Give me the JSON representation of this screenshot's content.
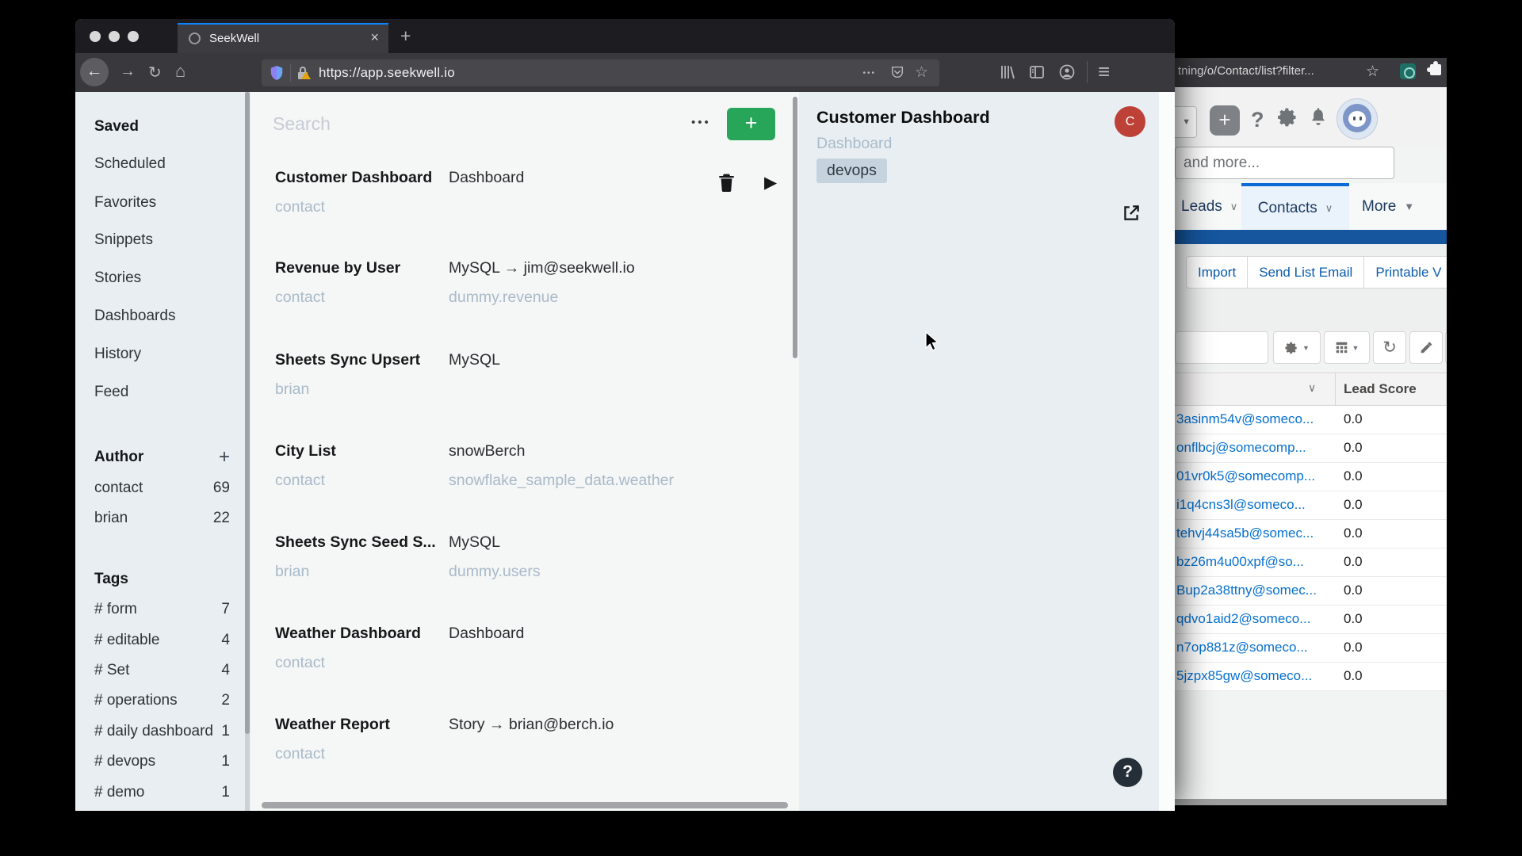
{
  "icons": {
    "back": "←",
    "forward": "→",
    "reload": "↻",
    "home": "⌂",
    "overflow_dots": "•••",
    "star": "☆",
    "menu": "≡",
    "close": "×",
    "new_tab": "+",
    "play": "▶",
    "chevron_down": "∨",
    "caret_down": "▼",
    "question": "?",
    "plus": "+"
  },
  "browser": {
    "tab_title": "SeekWell",
    "url": "https://app.seekwell.io"
  },
  "seekwell": {
    "sidebar": {
      "nav": [
        "Saved",
        "Scheduled",
        "Favorites",
        "Snippets",
        "Stories",
        "Dashboards",
        "History",
        "Feed"
      ],
      "author_label": "Author",
      "authors": [
        {
          "name": "contact",
          "count": "69"
        },
        {
          "name": "brian",
          "count": "22"
        }
      ],
      "tags_label": "Tags",
      "tags": [
        {
          "name": "# form",
          "count": "7"
        },
        {
          "name": "# editable",
          "count": "4"
        },
        {
          "name": "# Set",
          "count": "4"
        },
        {
          "name": "# operations",
          "count": "2"
        },
        {
          "name": "# daily dashboard",
          "count": "1"
        },
        {
          "name": "# devops",
          "count": "1"
        },
        {
          "name": "# demo",
          "count": "1"
        }
      ]
    },
    "list": {
      "search_placeholder": "Search",
      "items": [
        {
          "title": "Customer Dashboard",
          "type": "Dashboard",
          "author": "contact",
          "detail": ""
        },
        {
          "title": "Revenue by User",
          "type": "MySQL → jim@seekwell.io",
          "author": "contact",
          "detail": "dummy.revenue"
        },
        {
          "title": "Sheets Sync Upsert",
          "type": "MySQL",
          "author": "brian",
          "detail": ""
        },
        {
          "title": "City List",
          "type": "snowBerch",
          "author": "contact",
          "detail": "snowflake_sample_data.weather"
        },
        {
          "title": "Sheets Sync Seed S...",
          "type": "MySQL",
          "author": "brian",
          "detail": "dummy.users"
        },
        {
          "title": "Weather Dashboard",
          "type": "Dashboard",
          "author": "contact",
          "detail": ""
        },
        {
          "title": "Weather Report",
          "type": "Story → brian@berch.io",
          "author": "contact",
          "detail": ""
        }
      ]
    },
    "detail": {
      "title": "Customer Dashboard",
      "subtitle": "Dashboard",
      "tag": "devops",
      "avatar_initial": "C"
    }
  },
  "salesforce": {
    "url_fragment": "tning/o/Contact/list?filter...",
    "search_placeholder": "and more...",
    "tabs": [
      {
        "label": "Leads"
      },
      {
        "label": "Contacts"
      },
      {
        "label": "More"
      }
    ],
    "actions": [
      "Import",
      "Send List Email",
      "Printable V"
    ],
    "table": {
      "header": "Lead Score",
      "rows": [
        {
          "email": "3asinm54v@someco...",
          "score": "0.0"
        },
        {
          "email": "onflbcj@somecomp...",
          "score": "0.0"
        },
        {
          "email": "01vr0k5@somecomp...",
          "score": "0.0"
        },
        {
          "email": "i1q4cns3l@someco...",
          "score": "0.0"
        },
        {
          "email": "tehvj44sa5b@somec...",
          "score": "0.0"
        },
        {
          "email": "bz26m4u00xpf@so...",
          "score": "0.0"
        },
        {
          "email": "Bup2a38ttny@somec...",
          "score": "0.0"
        },
        {
          "email": "qdvo1aid2@someco...",
          "score": "0.0"
        },
        {
          "email": "n7op881z@someco...",
          "score": "0.0"
        },
        {
          "email": "5jzpx85gw@someco...",
          "score": "0.0"
        }
      ]
    }
  }
}
